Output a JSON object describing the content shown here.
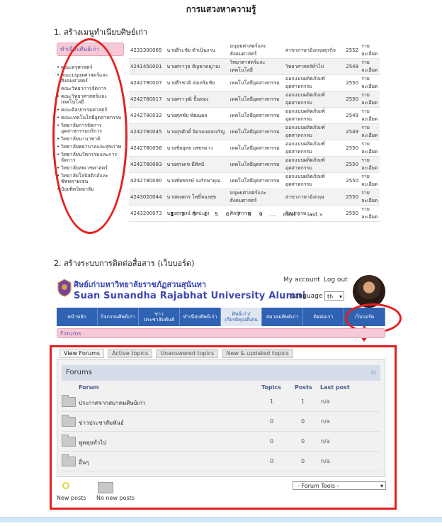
{
  "page_title": "การแสวงหาความรู้",
  "section1": {
    "heading": "1. สร้างเมนูทำเนียบศิษย์เก่า",
    "sidebar": {
      "title": "ทำเนียบศิษย์เก่า",
      "items": [
        "คณะครุศาสตร์",
        "คณะมนุษยศาสตร์และสังคมศาสตร์",
        "คณะวิทยาการจัดการ",
        "คณะวิทยาศาสตร์และเทคโนโลยี",
        "คณะศิลปกรรมศาสตร์",
        "คณะเทคโนโลยีอุตสาหกรรม",
        "วิทยาลัยการจัดการอุตสาหกรรมบริการ",
        "วิทยาลัยนานาชาติ",
        "วิทยาลัยพยาบาลและสุขภาพ",
        "วิทยาลัยนวัตกรรมและการจัดการ",
        "วิทยาลัยสหเวชศาสตร์",
        "วิทยาลัยโลจิสติกส์และซัพพลายเชน",
        "บัณฑิตวิทยาลัย"
      ]
    },
    "table": {
      "rows": [
        [
          "4233300065",
          "นายธีระชัย ดำเนินงาน",
          "มนุษยศาสตร์และสังคมศาสตร์",
          "สาขาภาษาอังกฤษธุรกิจ",
          "2552",
          "รายละเอียด"
        ],
        [
          "4241450001",
          "นายศราวุธ สัญชาตญาณ",
          "วิทยาศาสตร์และเทคโนโลยี",
          "วิทยาศาสตร์ทั่วไป",
          "2549",
          "รายละเอียด"
        ],
        [
          "4242780007",
          "นายธีรชาติ ส่งเสริมชัย",
          "เทคโนโลยีอุตสาหกรรม",
          "ออกแบบผลิตภัณฑ์อุตสาหกรรม",
          "2550",
          "รายละเอียด"
        ],
        [
          "4242780017",
          "นายศราวุฒิ ปั้นทอง",
          "เทคโนโลยีอุตสาหกรรม",
          "ออกแบบผลิตภัณฑ์อุตสาหกรรม",
          "2550",
          "รายละเอียด"
        ],
        [
          "4242780032",
          "นายศุภชัย พัฒนผล",
          "เทคโนโลยีอุตสาหกรรม",
          "ออกแบบผลิตภัณฑ์อุตสาหกรรม",
          "2549",
          "รายละเอียด"
        ],
        [
          "4242780045",
          "นายสุรศักดิ์ จิตรมงคลเจริญ",
          "เทคโนโลยีอุตสาหกรรม",
          "ออกแบบผลิตภัณฑ์อุตสาหกรรม",
          "2549",
          "รายละเอียด"
        ],
        [
          "4242780056",
          "นายชัยยุทธ เพชรดาว",
          "เทคโนโลยีอุตสาหกรรม",
          "ออกแบบผลิตภัณฑ์อุตสาหกรรม",
          "2550",
          "รายละเอียด"
        ],
        [
          "4242780083",
          "นายสุรเดช มีศิลป์",
          "เทคโนโลยีอุตสาหกรรม",
          "ออกแบบผลิตภัณฑ์อุตสาหกรรม",
          "2550",
          "รายละเอียด"
        ],
        [
          "4242780090",
          "นายชัยพรรษ์ จงรักษาคุณ",
          "เทคโนโลยีอุตสาหกรรม",
          "ออกแบบผลิตภัณฑ์อุตสาหกรรม",
          "2550",
          "รายละเอียด"
        ],
        [
          "4243020044",
          "นายพงศกร โพธิ์ทองสุข",
          "มนุษยศาสตร์และสังคมศาสตร์",
          "สาขาภาษาอังกฤษ",
          "2550",
          "รายละเอียด"
        ],
        [
          "4243200073",
          "นายสุรพงษ์ ศิลปะรุ่ง",
          "ศิลปกรรม",
          "ศิลปกรรม",
          "2550",
          "รายละเอียด"
        ]
      ]
    },
    "pager": {
      "pages": [
        "1",
        "2",
        "3",
        "4",
        "5",
        "6",
        "7",
        "8",
        "9",
        "…"
      ],
      "next": "next ›",
      "last": "last »"
    }
  },
  "section2": {
    "heading": "2. สร้างระบบการติดต่อสื่อสาร (เว็บบอร์ด)",
    "site_name_th": "ศิษย์เก่ามหาวิทยาลัยราชภัฏสวนสุนันทา",
    "site_name_en": "Suan Sunandha Rajabhat University Alumni",
    "my_account": "My account",
    "logout": "Log out",
    "language_label": "Language",
    "language_value": "th",
    "nav": [
      "หน้าหลัก",
      "กิจกรรมศิษย์เก่า",
      "ข่าวประชาสัมพันธ์",
      "ทำเนียบศิษย์เก่า",
      "ศิษย์เก่า/เกียรติคุณดีเด่น",
      "สมาคมศิษย์เก่า",
      "ติดต่อเรา",
      "เว็บบอร์ด"
    ],
    "forums_bar": "Forums",
    "tabs": [
      "View Forums",
      "Active topics",
      "Unanswered topics",
      "New & updated topics"
    ],
    "panel_title": "Forums",
    "columns": {
      "forum": "Forum",
      "topics": "Topics",
      "posts": "Posts",
      "last_post": "Last post"
    },
    "forums": [
      {
        "title": "ประกาศจากสมาคมศิษย์เก่า",
        "topics": "1",
        "posts": "1",
        "last": "n/a"
      },
      {
        "title": "ข่าวประชาสัมพันธ์",
        "topics": "0",
        "posts": "0",
        "last": "n/a"
      },
      {
        "title": "พูดคุยทั่วไป",
        "topics": "0",
        "posts": "0",
        "last": "n/a"
      },
      {
        "title": "อื่นๆ",
        "topics": "0",
        "posts": "0",
        "last": "n/a"
      }
    ],
    "legend_new": "New posts",
    "legend_no_new": "No new posts",
    "tools": "- Forum Tools -"
  },
  "colors": {
    "nav_blue": "#2f62b2",
    "highlight_red": "#e32020",
    "pink_bar": "#f6c9d6"
  }
}
